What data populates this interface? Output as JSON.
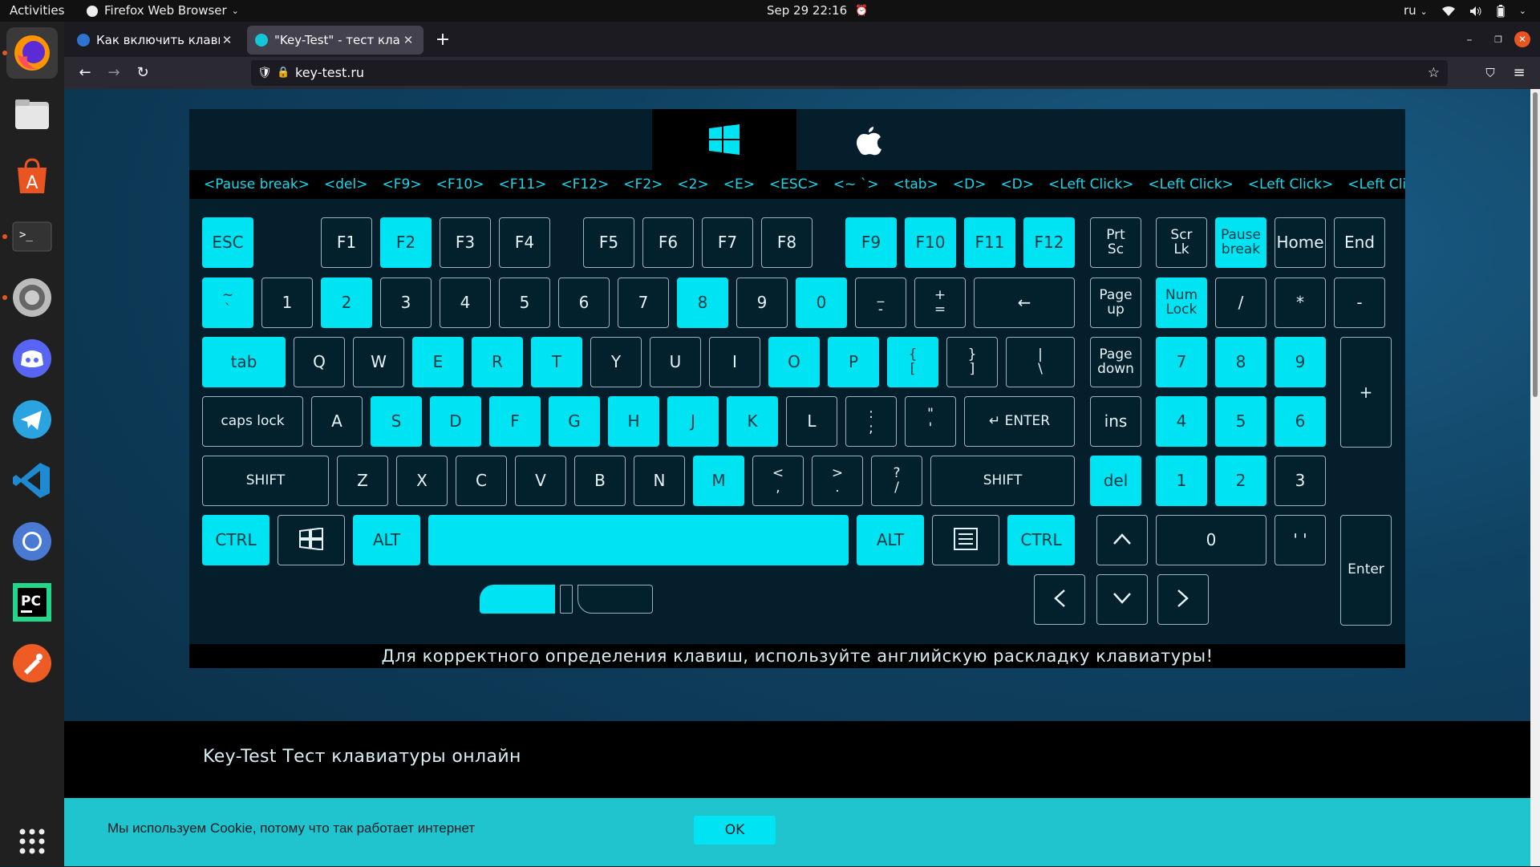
{
  "topbar": {
    "activities": "Activities",
    "app_name": "Firefox Web Browser",
    "datetime": "Sep 29  22:16",
    "language": "ru"
  },
  "dock": {
    "items": [
      {
        "name": "firefox-icon",
        "running": true
      },
      {
        "name": "files-icon",
        "running": false
      },
      {
        "name": "app-center-icon",
        "running": false
      },
      {
        "name": "terminal-icon",
        "running": true
      },
      {
        "name": "settings-icon",
        "running": true
      },
      {
        "name": "discord-icon",
        "running": false
      },
      {
        "name": "telegram-icon",
        "running": false
      },
      {
        "name": "vscode-icon",
        "running": false
      },
      {
        "name": "chromium-icon",
        "running": false
      },
      {
        "name": "pycharm-icon",
        "running": false
      },
      {
        "name": "postman-icon",
        "running": false
      },
      {
        "name": "show-apps-icon",
        "running": false
      }
    ]
  },
  "browser": {
    "tabs": [
      {
        "title": "Как включить клавишу Win",
        "active": false
      },
      {
        "title": "\"Key-Test\" - тест клавиатуры",
        "active": true
      }
    ],
    "url": "key-test.ru"
  },
  "page": {
    "history": [
      "<Pause break>",
      "<del>",
      "<F9>",
      "<F10>",
      "<F11>",
      "<F12>",
      "<F2>",
      "<2>",
      "<E>",
      "<ESC>",
      "<~ `>",
      "<tab>",
      "<D>",
      "<D>",
      "<Left Click>",
      "<Left Click>",
      "<Left Click>",
      "<Left Click>"
    ],
    "layout_note": "Для корректного определения клавиш, используйте английскую раскладку клавиатуры!",
    "footer_title": "Key-Test Тест клавиатуры онлайн",
    "cookie_text": "Мы используем Cookie, потому что так работает интернет",
    "cookie_ok": "OK"
  },
  "keyboard": {
    "keys": [
      {
        "id": "esc",
        "label": "ESC",
        "on": true
      },
      {
        "id": "f1",
        "label": "F1",
        "on": false
      },
      {
        "id": "f2",
        "label": "F2",
        "on": true
      },
      {
        "id": "f3",
        "label": "F3",
        "on": false
      },
      {
        "id": "f4",
        "label": "F4",
        "on": false
      },
      {
        "id": "f5",
        "label": "F5",
        "on": false
      },
      {
        "id": "f6",
        "label": "F6",
        "on": false
      },
      {
        "id": "f7",
        "label": "F7",
        "on": false
      },
      {
        "id": "f8",
        "label": "F8",
        "on": false
      },
      {
        "id": "f9",
        "label": "F9",
        "on": true
      },
      {
        "id": "f10",
        "label": "F10",
        "on": true
      },
      {
        "id": "f11",
        "label": "F11",
        "on": true
      },
      {
        "id": "f12",
        "label": "F12",
        "on": true
      },
      {
        "id": "prtsc",
        "label": "Prt\nSc",
        "on": false
      },
      {
        "id": "scrlk",
        "label": "Scr\nLk",
        "on": false
      },
      {
        "id": "pause",
        "label": "Pause\nbreak",
        "on": true
      },
      {
        "id": "home",
        "label": "Home",
        "on": false
      },
      {
        "id": "end",
        "label": "End",
        "on": false
      },
      {
        "id": "tilde",
        "label": "~\n`",
        "on": true
      },
      {
        "id": "k1",
        "label": "1",
        "on": false
      },
      {
        "id": "k2",
        "label": "2",
        "on": true
      },
      {
        "id": "k3",
        "label": "3",
        "on": false
      },
      {
        "id": "k4",
        "label": "4",
        "on": false
      },
      {
        "id": "k5",
        "label": "5",
        "on": false
      },
      {
        "id": "k6",
        "label": "6",
        "on": false
      },
      {
        "id": "k7",
        "label": "7",
        "on": false
      },
      {
        "id": "k8",
        "label": "8",
        "on": true
      },
      {
        "id": "k9",
        "label": "9",
        "on": false
      },
      {
        "id": "k0",
        "label": "0",
        "on": true
      },
      {
        "id": "minus",
        "label": "_\n-",
        "on": false
      },
      {
        "id": "equal",
        "label": "+\n=",
        "on": false
      },
      {
        "id": "backspace",
        "label": "←",
        "on": false
      },
      {
        "id": "pgup",
        "label": "Page\nup",
        "on": false
      },
      {
        "id": "numlock",
        "label": "Num\nLock",
        "on": true
      },
      {
        "id": "npdiv",
        "label": "/",
        "on": false
      },
      {
        "id": "npmul",
        "label": "*",
        "on": false
      },
      {
        "id": "npsub",
        "label": "-",
        "on": false
      },
      {
        "id": "tab",
        "label": "tab",
        "on": true
      },
      {
        "id": "q",
        "label": "Q",
        "on": false
      },
      {
        "id": "w",
        "label": "W",
        "on": false
      },
      {
        "id": "e",
        "label": "E",
        "on": true
      },
      {
        "id": "r",
        "label": "R",
        "on": true
      },
      {
        "id": "t",
        "label": "T",
        "on": true
      },
      {
        "id": "y",
        "label": "Y",
        "on": false
      },
      {
        "id": "u",
        "label": "U",
        "on": false
      },
      {
        "id": "i",
        "label": "I",
        "on": false
      },
      {
        "id": "o",
        "label": "O",
        "on": true
      },
      {
        "id": "p",
        "label": "P",
        "on": true
      },
      {
        "id": "lbrace",
        "label": "{\n[",
        "on": true
      },
      {
        "id": "rbrace",
        "label": "}\n]",
        "on": false
      },
      {
        "id": "backslash",
        "label": "|\n\\",
        "on": false
      },
      {
        "id": "pgdn",
        "label": "Page\ndown",
        "on": false
      },
      {
        "id": "np7",
        "label": "7",
        "on": true
      },
      {
        "id": "np8",
        "label": "8",
        "on": true
      },
      {
        "id": "np9",
        "label": "9",
        "on": true
      },
      {
        "id": "npadd",
        "label": "+",
        "on": false
      },
      {
        "id": "caps",
        "label": "caps lock",
        "on": false
      },
      {
        "id": "a",
        "label": "A",
        "on": false
      },
      {
        "id": "s",
        "label": "S",
        "on": true
      },
      {
        "id": "d",
        "label": "D",
        "on": true
      },
      {
        "id": "f",
        "label": "F",
        "on": true
      },
      {
        "id": "g",
        "label": "G",
        "on": true
      },
      {
        "id": "h",
        "label": "H",
        "on": true
      },
      {
        "id": "j",
        "label": "J",
        "on": true
      },
      {
        "id": "k",
        "label": "K",
        "on": true
      },
      {
        "id": "l",
        "label": "L",
        "on": false
      },
      {
        "id": "semicolon",
        "label": ":\n;",
        "on": false
      },
      {
        "id": "quote",
        "label": "\"\n'",
        "on": false
      },
      {
        "id": "enter",
        "label": "↵ ENTER",
        "on": false
      },
      {
        "id": "ins",
        "label": "ins",
        "on": false
      },
      {
        "id": "np4",
        "label": "4",
        "on": true
      },
      {
        "id": "np5",
        "label": "5",
        "on": true
      },
      {
        "id": "np6",
        "label": "6",
        "on": true
      },
      {
        "id": "lshift",
        "label": "SHIFT",
        "on": false
      },
      {
        "id": "z",
        "label": "Z",
        "on": false
      },
      {
        "id": "x",
        "label": "X",
        "on": false
      },
      {
        "id": "c",
        "label": "C",
        "on": false
      },
      {
        "id": "v",
        "label": "V",
        "on": false
      },
      {
        "id": "b",
        "label": "B",
        "on": false
      },
      {
        "id": "n",
        "label": "N",
        "on": false
      },
      {
        "id": "m",
        "label": "M",
        "on": true
      },
      {
        "id": "comma",
        "label": "<\n,",
        "on": false
      },
      {
        "id": "period",
        "label": ">\n.",
        "on": false
      },
      {
        "id": "slash",
        "label": "?\n/",
        "on": false
      },
      {
        "id": "rshift",
        "label": "SHIFT",
        "on": false
      },
      {
        "id": "del",
        "label": "del",
        "on": true
      },
      {
        "id": "np1",
        "label": "1",
        "on": true
      },
      {
        "id": "np2",
        "label": "2",
        "on": true
      },
      {
        "id": "np3",
        "label": "3",
        "on": false
      },
      {
        "id": "lctrl",
        "label": "CTRL",
        "on": true
      },
      {
        "id": "win",
        "label": "",
        "on": false,
        "icon": "windows-logo-icon"
      },
      {
        "id": "lalt",
        "label": "ALT",
        "on": true
      },
      {
        "id": "space",
        "label": "",
        "on": true
      },
      {
        "id": "ralt",
        "label": "ALT",
        "on": true
      },
      {
        "id": "menu",
        "label": "",
        "on": false,
        "icon": "context-menu-icon"
      },
      {
        "id": "rctrl",
        "label": "CTRL",
        "on": true
      },
      {
        "id": "up",
        "label": "",
        "on": false,
        "icon": "arrow-up-icon"
      },
      {
        "id": "np0",
        "label": "0",
        "on": false
      },
      {
        "id": "npdot",
        "label": "' '",
        "on": false
      },
      {
        "id": "npenter",
        "label": "Enter",
        "on": false
      },
      {
        "id": "left",
        "label": "",
        "on": false,
        "icon": "arrow-left-icon"
      },
      {
        "id": "down",
        "label": "",
        "on": false,
        "icon": "arrow-down-icon"
      },
      {
        "id": "right",
        "label": "",
        "on": false,
        "icon": "arrow-right-icon"
      }
    ],
    "mouse": {
      "left_button": true,
      "wheel": false,
      "right_button": false
    }
  }
}
